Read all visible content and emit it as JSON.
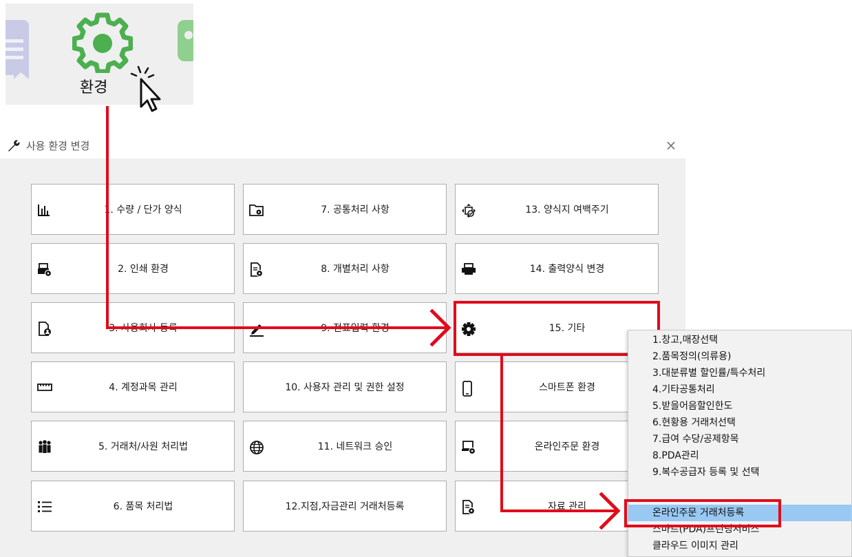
{
  "toolbar": {
    "env_label": "환경",
    "icons": [
      "document-icon",
      "gear-icon",
      "pointer-cursor-icon"
    ],
    "accent_color": "#4caf50"
  },
  "dialog": {
    "title": "사용 환경 변경",
    "close_label": "×",
    "buttons": [
      {
        "label": "1. 수량 / 단가 양식",
        "icon": "bar-chart-icon"
      },
      {
        "label": "7. 공통처리 사항",
        "icon": "folder-gear-icon"
      },
      {
        "label": "13. 양식지 여백주기",
        "icon": "margin-adjust-icon"
      },
      {
        "label": "2. 인쇄 환경",
        "icon": "printer-gear-icon"
      },
      {
        "label": "8. 개별처리 사항",
        "icon": "document-gear-icon"
      },
      {
        "label": "14. 출력양식 변경",
        "icon": "printer-icon"
      },
      {
        "label": "3. 사용회사 등록",
        "icon": "company-doc-icon"
      },
      {
        "label": "9. 전표입력 환경",
        "icon": "pencil-icon"
      },
      {
        "label": "15. 기타",
        "icon": "gear-icon"
      },
      {
        "label": "4. 계정과목 관리",
        "icon": "ruler-icon"
      },
      {
        "label": "10. 사용자 관리 및 권한 설정",
        "icon": ""
      },
      {
        "label": "스마트폰 환경",
        "icon": "smartphone-icon"
      },
      {
        "label": "5. 거래처/사원 처리법",
        "icon": "people-icon"
      },
      {
        "label": "11. 네트워크 승인",
        "icon": "globe-icon"
      },
      {
        "label": "온라인주문 환경",
        "icon": "laptop-gear-icon"
      },
      {
        "label": "6. 품목 처리법",
        "icon": "list-icon"
      },
      {
        "label": "12.지점,자금관리 거래처등록",
        "icon": ""
      },
      {
        "label": "자료 관리",
        "icon": "document-gear-icon"
      }
    ]
  },
  "menu": {
    "items": [
      "1.창고,매장선택",
      "2.품목정의(의류용)",
      "3.대분류별 할인률/특수처리",
      "4.기타공통처리",
      "5.받을어음할인한도",
      "6.현황용 거래처선택",
      "7.급여 수당/공제항목",
      "8.PDA관리",
      "9.복수공급자 등록 및 선택",
      "온라인주문 거래처등록",
      "스마트(PDA)프린팅서비스",
      "클라우드 이미지 관리"
    ],
    "selected_index": 9,
    "selected_color": "#99c9f2"
  },
  "annotation": {
    "arrow_color": "#e00b1b"
  }
}
